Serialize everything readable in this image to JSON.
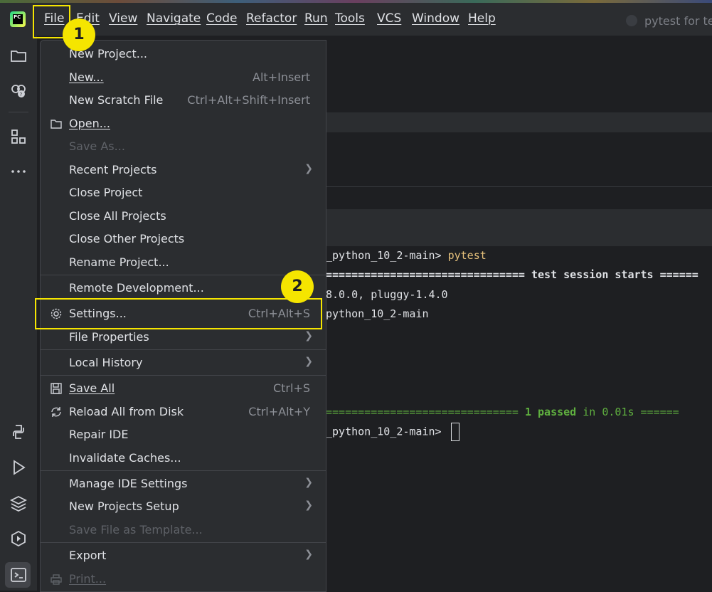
{
  "menubar": {
    "items": [
      "File",
      "Edit",
      "View",
      "Navigate",
      "Code",
      "Refactor",
      "Run",
      "Tools",
      "VCS",
      "Window",
      "Help"
    ],
    "window_title": "pytest for te"
  },
  "logo": {
    "text": "PC"
  },
  "file_menu": {
    "new_project": "New Project...",
    "new": "New...",
    "new_shortcut": "Alt+Insert",
    "new_scratch": "New Scratch File",
    "new_scratch_shortcut": "Ctrl+Alt+Shift+Insert",
    "open": "Open...",
    "save_as": "Save As...",
    "recent_projects": "Recent Projects",
    "close_project": "Close Project",
    "close_all_projects": "Close All Projects",
    "close_other_projects": "Close Other Projects",
    "rename_project": "Rename Project...",
    "remote_development": "Remote Development...",
    "settings": "Settings...",
    "settings_shortcut": "Ctrl+Alt+S",
    "file_properties": "File Properties",
    "local_history": "Local History",
    "save_all": "Save All",
    "save_all_shortcut": "Ctrl+S",
    "reload_all": "Reload All from Disk",
    "reload_all_shortcut": "Ctrl+Alt+Y",
    "repair_ide": "Repair IDE",
    "invalidate_caches": "Invalidate Caches...",
    "manage_ide_settings": "Manage IDE Settings",
    "new_projects_setup": "New Projects Setup",
    "save_file_as_template": "Save File as Template...",
    "export": "Export",
    "print": "Print..."
  },
  "terminal": {
    "line1_prefix": "_python_10_2-main> ",
    "line1_cmd": "pytest",
    "line2_rule": "=============================== ",
    "line2_text": "test session starts",
    "line2_rule_end": " ======",
    "line3": "8.0.0, pluggy-1.4.0",
    "line4": "python_10_2-main",
    "line5_rule": "============================== ",
    "line5_passed": "1 passed",
    "line5_time": " in 0.01s",
    "line5_rule_end": " ======",
    "line6_prefix": "_python_10_2-main> "
  },
  "annotations": {
    "step1": "1",
    "step2": "2"
  },
  "colors": {
    "highlight": "#f5e500",
    "menu_bg": "#2b2d30",
    "editor_bg": "#1e1f22",
    "prompt_yellow": "#e5c07b",
    "pass_green": "#5faf3f"
  },
  "icons": [
    "folder-icon",
    "copilot-icon",
    "structure-icon",
    "more-icon",
    "python-icon",
    "run-icon",
    "layers-icon",
    "services-icon",
    "terminal-icon"
  ]
}
